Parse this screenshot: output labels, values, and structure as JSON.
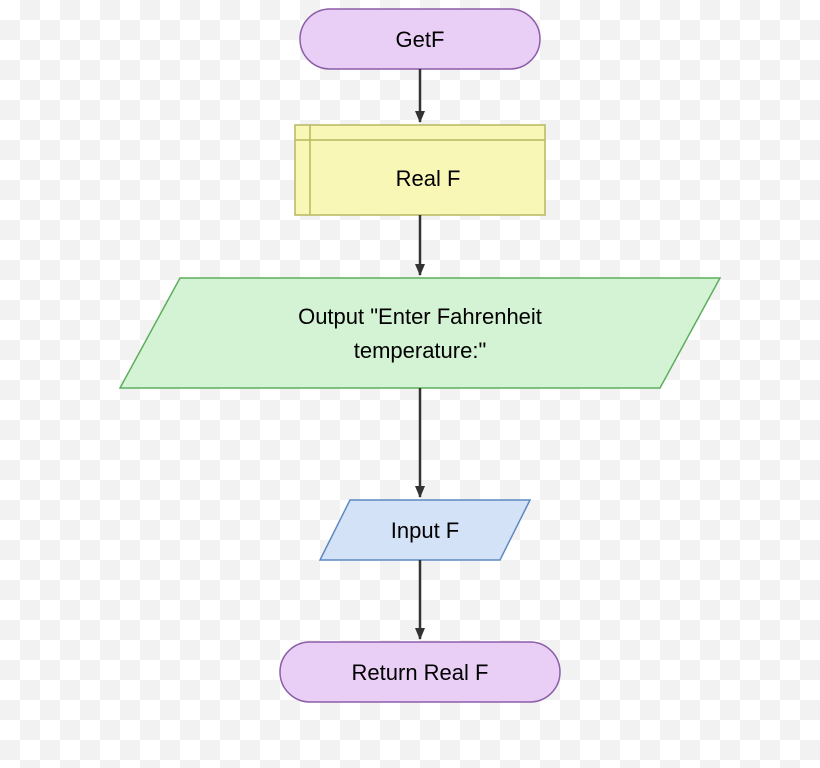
{
  "flowchart": {
    "nodes": {
      "start": {
        "label": "GetF",
        "shape": "terminator",
        "fill": "#E9CFF6",
        "stroke": "#8C5DA8"
      },
      "declare": {
        "label": "Real F",
        "shape": "declaration",
        "fill": "#F8F7B6",
        "stroke": "#B8B85F"
      },
      "output": {
        "line1": "Output \"Enter Fahrenheit",
        "line2": "temperature:\"",
        "shape": "io",
        "fill": "#D4F2D4",
        "stroke": "#5CAE5C"
      },
      "input": {
        "label": "Input F",
        "shape": "io",
        "fill": "#D4E2F7",
        "stroke": "#5C88C4"
      },
      "return": {
        "label": "Return Real F",
        "shape": "terminator",
        "fill": "#E9CFF6",
        "stroke": "#8C5DA8"
      }
    },
    "arrow_color": "#333333"
  }
}
